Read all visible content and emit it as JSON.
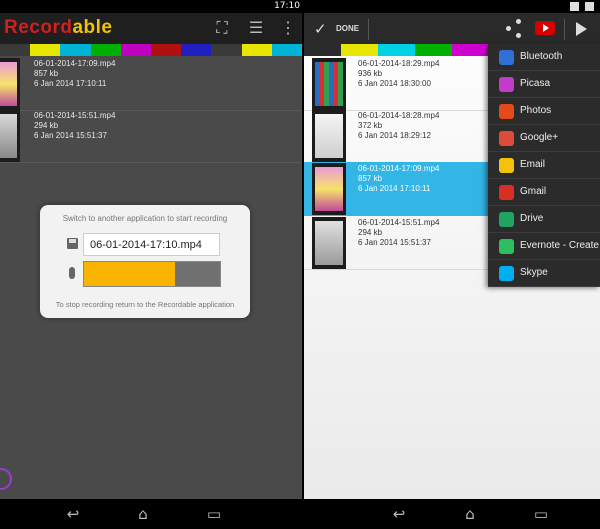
{
  "left": {
    "statusbar": {
      "time": "17:10"
    },
    "app_title_part1": "Record",
    "app_title_part2": "able",
    "colors": {
      "red": "#d21f1f",
      "yellow": "#f2c300",
      "accent": "#f8b400"
    },
    "color_strip": [
      "#3a3a3a",
      "#e6e600",
      "#00b4d8",
      "#00b000",
      "#c000c0",
      "#b01010",
      "#2020c0",
      "#3a3a3a",
      "#e6e600",
      "#00b4d8"
    ],
    "recordings": [
      {
        "name": "06-01-2014-17:09.mp4",
        "size": "857 kb",
        "date": "6 Jan 2014 17:10:11"
      },
      {
        "name": "06-01-2014-15:51.mp4",
        "size": "294 kb",
        "date": "6 Jan 2014 15:51:37"
      }
    ],
    "dialog": {
      "top_text": "Switch to another application to start recording",
      "filename": "06-01-2014-17:10.mp4",
      "level_fraction": 0.67,
      "bottom_text": "To stop recording return to the Recordable application"
    }
  },
  "right": {
    "done_label": "DONE",
    "color_strip": [
      "#2a2a2a",
      "#e6e600",
      "#00d2e6",
      "#00b000",
      "#d000d0",
      "#c01010",
      "#2020c0",
      "#2a2a2a"
    ],
    "recordings": [
      {
        "name": "06-01-2014-18:29.mp4",
        "size": "936 kb",
        "date": "6 Jan 2014 18:30:00",
        "selected": false
      },
      {
        "name": "06-01-2014-18:28.mp4",
        "size": "372 kb",
        "date": "6 Jan 2014 18:29:12",
        "selected": false
      },
      {
        "name": "06-01-2014-17:09.mp4",
        "size": "857 kb",
        "date": "6 Jan 2014 17:10:11",
        "selected": true
      },
      {
        "name": "06-01-2014-15:51.mp4",
        "size": "294 kb",
        "date": "6 Jan 2014 15:51:37",
        "selected": false
      }
    ],
    "share_menu": [
      {
        "label": "Bluetooth",
        "icon": "bluetooth-icon",
        "color": "#2f6fd6"
      },
      {
        "label": "Picasa",
        "icon": "picasa-icon",
        "color": "#c33cc7"
      },
      {
        "label": "Photos",
        "icon": "photos-icon",
        "color": "#e64a19"
      },
      {
        "label": "Google+",
        "icon": "google-plus-icon",
        "color": "#dd4b39"
      },
      {
        "label": "Email",
        "icon": "email-icon",
        "color": "#f4c20d"
      },
      {
        "label": "Gmail",
        "icon": "gmail-icon",
        "color": "#d93025"
      },
      {
        "label": "Drive",
        "icon": "drive-icon",
        "color": "#1fa463"
      },
      {
        "label": "Evernote - Create",
        "icon": "evernote-icon",
        "color": "#2dbe60"
      },
      {
        "label": "Skype",
        "icon": "skype-icon",
        "color": "#00aff0"
      }
    ]
  }
}
